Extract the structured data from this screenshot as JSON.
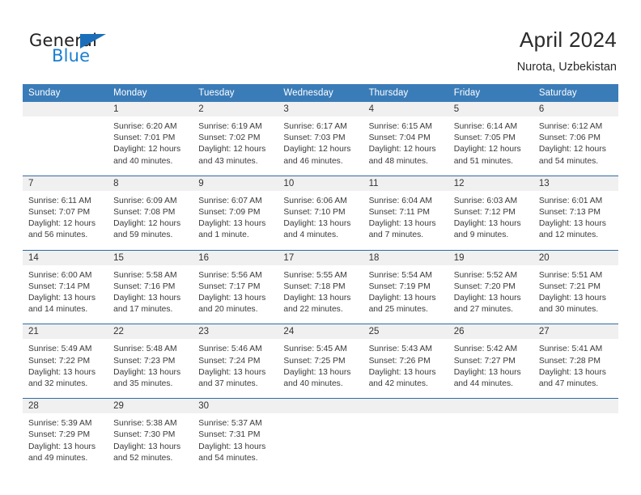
{
  "brand": {
    "name_top": "General",
    "name_bottom": "Blue",
    "color_black": "#231f20",
    "color_blue": "#1b7fd0",
    "triangle_color": "#1b6fba"
  },
  "header": {
    "title": "April 2024",
    "subtitle": "Nurota, Uzbekistan"
  },
  "theme": {
    "header_bg": "#3a7cb8",
    "row_divider": "#2e6da4",
    "daynum_bg": "#f0f0f0",
    "text": "#3a3a3a"
  },
  "weekdays": [
    "Sunday",
    "Monday",
    "Tuesday",
    "Wednesday",
    "Thursday",
    "Friday",
    "Saturday"
  ],
  "weeks": [
    [
      {
        "day": "",
        "sunrise": "",
        "sunset": "",
        "daylight1": "",
        "daylight2": ""
      },
      {
        "day": "1",
        "sunrise": "Sunrise: 6:20 AM",
        "sunset": "Sunset: 7:01 PM",
        "daylight1": "Daylight: 12 hours",
        "daylight2": "and 40 minutes."
      },
      {
        "day": "2",
        "sunrise": "Sunrise: 6:19 AM",
        "sunset": "Sunset: 7:02 PM",
        "daylight1": "Daylight: 12 hours",
        "daylight2": "and 43 minutes."
      },
      {
        "day": "3",
        "sunrise": "Sunrise: 6:17 AM",
        "sunset": "Sunset: 7:03 PM",
        "daylight1": "Daylight: 12 hours",
        "daylight2": "and 46 minutes."
      },
      {
        "day": "4",
        "sunrise": "Sunrise: 6:15 AM",
        "sunset": "Sunset: 7:04 PM",
        "daylight1": "Daylight: 12 hours",
        "daylight2": "and 48 minutes."
      },
      {
        "day": "5",
        "sunrise": "Sunrise: 6:14 AM",
        "sunset": "Sunset: 7:05 PM",
        "daylight1": "Daylight: 12 hours",
        "daylight2": "and 51 minutes."
      },
      {
        "day": "6",
        "sunrise": "Sunrise: 6:12 AM",
        "sunset": "Sunset: 7:06 PM",
        "daylight1": "Daylight: 12 hours",
        "daylight2": "and 54 minutes."
      }
    ],
    [
      {
        "day": "7",
        "sunrise": "Sunrise: 6:11 AM",
        "sunset": "Sunset: 7:07 PM",
        "daylight1": "Daylight: 12 hours",
        "daylight2": "and 56 minutes."
      },
      {
        "day": "8",
        "sunrise": "Sunrise: 6:09 AM",
        "sunset": "Sunset: 7:08 PM",
        "daylight1": "Daylight: 12 hours",
        "daylight2": "and 59 minutes."
      },
      {
        "day": "9",
        "sunrise": "Sunrise: 6:07 AM",
        "sunset": "Sunset: 7:09 PM",
        "daylight1": "Daylight: 13 hours",
        "daylight2": "and 1 minute."
      },
      {
        "day": "10",
        "sunrise": "Sunrise: 6:06 AM",
        "sunset": "Sunset: 7:10 PM",
        "daylight1": "Daylight: 13 hours",
        "daylight2": "and 4 minutes."
      },
      {
        "day": "11",
        "sunrise": "Sunrise: 6:04 AM",
        "sunset": "Sunset: 7:11 PM",
        "daylight1": "Daylight: 13 hours",
        "daylight2": "and 7 minutes."
      },
      {
        "day": "12",
        "sunrise": "Sunrise: 6:03 AM",
        "sunset": "Sunset: 7:12 PM",
        "daylight1": "Daylight: 13 hours",
        "daylight2": "and 9 minutes."
      },
      {
        "day": "13",
        "sunrise": "Sunrise: 6:01 AM",
        "sunset": "Sunset: 7:13 PM",
        "daylight1": "Daylight: 13 hours",
        "daylight2": "and 12 minutes."
      }
    ],
    [
      {
        "day": "14",
        "sunrise": "Sunrise: 6:00 AM",
        "sunset": "Sunset: 7:14 PM",
        "daylight1": "Daylight: 13 hours",
        "daylight2": "and 14 minutes."
      },
      {
        "day": "15",
        "sunrise": "Sunrise: 5:58 AM",
        "sunset": "Sunset: 7:16 PM",
        "daylight1": "Daylight: 13 hours",
        "daylight2": "and 17 minutes."
      },
      {
        "day": "16",
        "sunrise": "Sunrise: 5:56 AM",
        "sunset": "Sunset: 7:17 PM",
        "daylight1": "Daylight: 13 hours",
        "daylight2": "and 20 minutes."
      },
      {
        "day": "17",
        "sunrise": "Sunrise: 5:55 AM",
        "sunset": "Sunset: 7:18 PM",
        "daylight1": "Daylight: 13 hours",
        "daylight2": "and 22 minutes."
      },
      {
        "day": "18",
        "sunrise": "Sunrise: 5:54 AM",
        "sunset": "Sunset: 7:19 PM",
        "daylight1": "Daylight: 13 hours",
        "daylight2": "and 25 minutes."
      },
      {
        "day": "19",
        "sunrise": "Sunrise: 5:52 AM",
        "sunset": "Sunset: 7:20 PM",
        "daylight1": "Daylight: 13 hours",
        "daylight2": "and 27 minutes."
      },
      {
        "day": "20",
        "sunrise": "Sunrise: 5:51 AM",
        "sunset": "Sunset: 7:21 PM",
        "daylight1": "Daylight: 13 hours",
        "daylight2": "and 30 minutes."
      }
    ],
    [
      {
        "day": "21",
        "sunrise": "Sunrise: 5:49 AM",
        "sunset": "Sunset: 7:22 PM",
        "daylight1": "Daylight: 13 hours",
        "daylight2": "and 32 minutes."
      },
      {
        "day": "22",
        "sunrise": "Sunrise: 5:48 AM",
        "sunset": "Sunset: 7:23 PM",
        "daylight1": "Daylight: 13 hours",
        "daylight2": "and 35 minutes."
      },
      {
        "day": "23",
        "sunrise": "Sunrise: 5:46 AM",
        "sunset": "Sunset: 7:24 PM",
        "daylight1": "Daylight: 13 hours",
        "daylight2": "and 37 minutes."
      },
      {
        "day": "24",
        "sunrise": "Sunrise: 5:45 AM",
        "sunset": "Sunset: 7:25 PM",
        "daylight1": "Daylight: 13 hours",
        "daylight2": "and 40 minutes."
      },
      {
        "day": "25",
        "sunrise": "Sunrise: 5:43 AM",
        "sunset": "Sunset: 7:26 PM",
        "daylight1": "Daylight: 13 hours",
        "daylight2": "and 42 minutes."
      },
      {
        "day": "26",
        "sunrise": "Sunrise: 5:42 AM",
        "sunset": "Sunset: 7:27 PM",
        "daylight1": "Daylight: 13 hours",
        "daylight2": "and 44 minutes."
      },
      {
        "day": "27",
        "sunrise": "Sunrise: 5:41 AM",
        "sunset": "Sunset: 7:28 PM",
        "daylight1": "Daylight: 13 hours",
        "daylight2": "and 47 minutes."
      }
    ],
    [
      {
        "day": "28",
        "sunrise": "Sunrise: 5:39 AM",
        "sunset": "Sunset: 7:29 PM",
        "daylight1": "Daylight: 13 hours",
        "daylight2": "and 49 minutes."
      },
      {
        "day": "29",
        "sunrise": "Sunrise: 5:38 AM",
        "sunset": "Sunset: 7:30 PM",
        "daylight1": "Daylight: 13 hours",
        "daylight2": "and 52 minutes."
      },
      {
        "day": "30",
        "sunrise": "Sunrise: 5:37 AM",
        "sunset": "Sunset: 7:31 PM",
        "daylight1": "Daylight: 13 hours",
        "daylight2": "and 54 minutes."
      },
      {
        "day": "",
        "sunrise": "",
        "sunset": "",
        "daylight1": "",
        "daylight2": ""
      },
      {
        "day": "",
        "sunrise": "",
        "sunset": "",
        "daylight1": "",
        "daylight2": ""
      },
      {
        "day": "",
        "sunrise": "",
        "sunset": "",
        "daylight1": "",
        "daylight2": ""
      },
      {
        "day": "",
        "sunrise": "",
        "sunset": "",
        "daylight1": "",
        "daylight2": ""
      }
    ]
  ]
}
